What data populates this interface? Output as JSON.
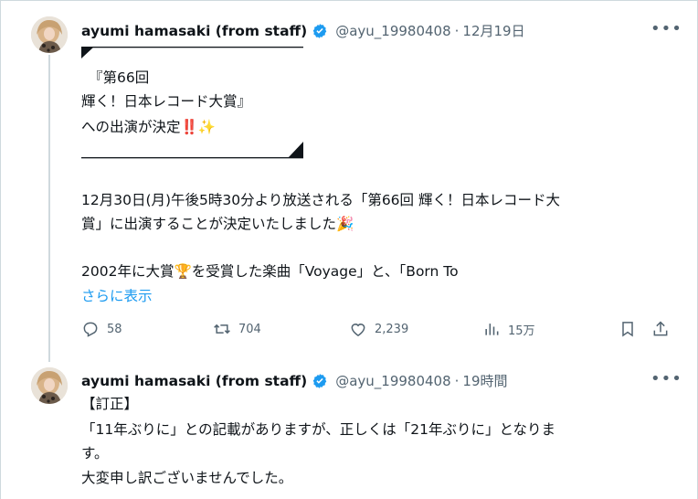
{
  "tweet1": {
    "name": "ayumi hamasaki (from staff)",
    "handle": "@ayu_19980408",
    "separator": "·",
    "time": "12月19日",
    "lines": [
      "『第66回",
      "輝く！日本レコード大賞』",
      "への出演が決定‼️✨",
      "12月30日(月)午後5時30分より放送される「第66回 輝く！日本レコード大",
      "賞」に出演することが決定いたしました🎉",
      "2002年に大賞🏆を受賞した楽曲「Voyage」と、「Born To"
    ],
    "show_more": "さらに表示",
    "stats": {
      "replies": "58",
      "reposts": "704",
      "likes": "2,239",
      "views": "15万"
    }
  },
  "tweet2": {
    "name": "ayumi hamasaki (from staff)",
    "handle": "@ayu_19980408",
    "separator": "·",
    "time": "19時間",
    "lines": [
      "【訂正】",
      "「11年ぶりに」との記載がありますが、正しくは「21年ぶりに」となりま",
      "す。",
      "大変申し訳ございませんでした。"
    ]
  },
  "icons": [
    "avatar",
    "verified-badge-icon",
    "more-options-icon",
    "reply-icon",
    "repost-icon",
    "like-icon",
    "views-icon",
    "bookmark-icon",
    "share-icon"
  ],
  "colors": {
    "text": "#0f1419",
    "secondary": "#536471",
    "link": "#1d9bf0",
    "verified": "#1d9bf0",
    "border": "#cfd9de"
  }
}
